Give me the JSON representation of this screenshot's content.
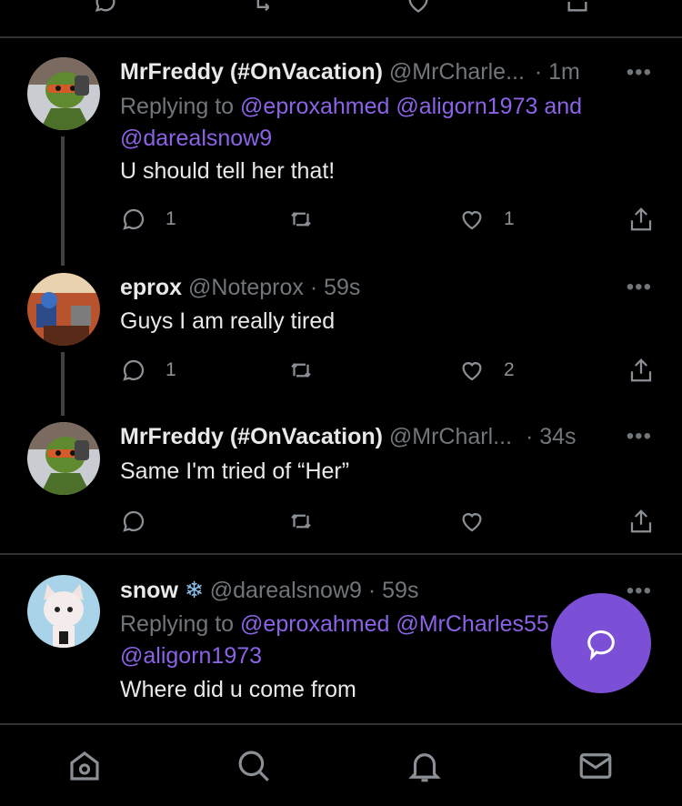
{
  "colors": {
    "background": "#000000",
    "link": "#8b63e6",
    "muted": "#71767b",
    "fab": "#7b4fd6"
  },
  "tweets": [
    {
      "name": "MrFreddy (#OnVacation)",
      "handle": "@MrCharle...",
      "time": "· 1m",
      "reply_prefix": "Replying to",
      "mention1": "@eproxahmed",
      "mention2": "@aligorn1973",
      "and": "and",
      "mention3": "@darealsnow9",
      "text": "U should tell her that!",
      "replies": "1",
      "likes": "1"
    },
    {
      "name": "eprox",
      "handle": "@Noteprox",
      "time": "· 59s",
      "text": "Guys I am really tired",
      "replies": "1",
      "likes": "2"
    },
    {
      "name": "MrFreddy (#OnVacation)",
      "handle": "@MrCharl...",
      "time": "· 34s",
      "text": "Same I'm tried of “Her”"
    },
    {
      "name": "snow",
      "name_icon": "snowflake-icon",
      "handle": "@darealsnow9",
      "time": "· 59s",
      "reply_prefix": "Replying to",
      "mention1": "@eproxahmed",
      "mention2": "@MrCharles55",
      "mention3": "@aligorn1973",
      "text": "Where did u come from"
    }
  ],
  "more_label": "•••",
  "snowflake_glyph": "❄",
  "bottom_nav": [
    "home-icon",
    "search-icon",
    "notifications-icon",
    "messages-icon"
  ],
  "fab_icon": "compose-reply-icon"
}
